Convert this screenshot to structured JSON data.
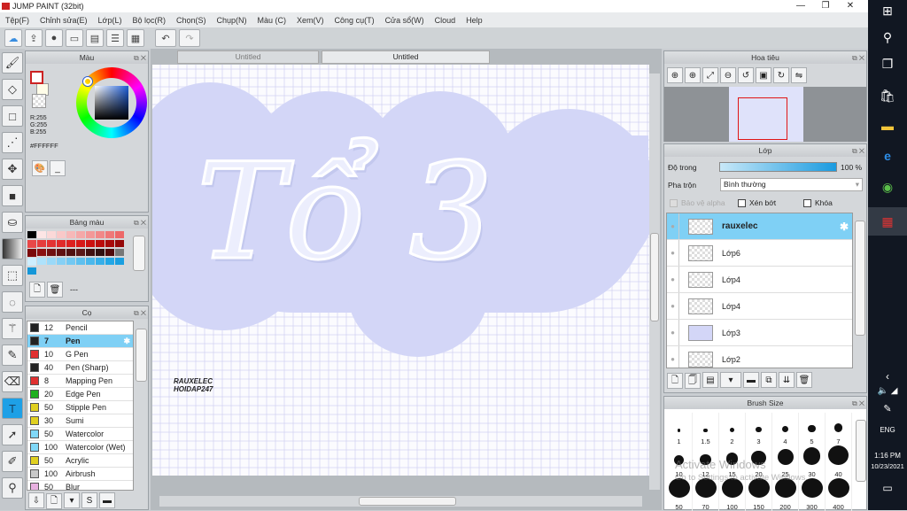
{
  "window": {
    "title": "JUMP PAINT (32bit)",
    "minimize": "—",
    "restore": "❐",
    "close": "✕"
  },
  "menu": [
    "Tệp(F)",
    "Chỉnh sửa(E)",
    "Lớp(L)",
    "Bộ lọc(R)",
    "Chọn(S)",
    "Chụp(N)",
    "Màu (C)",
    "Xem(V)",
    "Công cụ(T)",
    "Cửa sổ(W)",
    "Cloud",
    "Help"
  ],
  "toolbar": {
    "icons": [
      "cloud-icon",
      "share-icon",
      "comment-icon",
      "screen-icon",
      "page-icon",
      "list-icon",
      "grid-icon"
    ],
    "undo": "↶",
    "redo": "↷"
  },
  "color_panel": {
    "title": "Màu",
    "r": "R:255",
    "g": "G:255",
    "b": "B:255",
    "hex": "#FFFFFF",
    "extra_btn": "_"
  },
  "palette_panel": {
    "title": "Bảng màu",
    "label": "---"
  },
  "brush_panel": {
    "title": "Cọ",
    "items": [
      {
        "size": "12",
        "name": "Pencil",
        "color": "#222222"
      },
      {
        "size": "7",
        "name": "Pen",
        "color": "#222222",
        "selected": true
      },
      {
        "size": "10",
        "name": "G Pen",
        "color": "#e03030"
      },
      {
        "size": "40",
        "name": "Pen (Sharp)",
        "color": "#222222"
      },
      {
        "size": "8",
        "name": "Mapping Pen",
        "color": "#e03030"
      },
      {
        "size": "20",
        "name": "Edge Pen",
        "color": "#20b020"
      },
      {
        "size": "50",
        "name": "Stipple Pen",
        "color": "#e0d020"
      },
      {
        "size": "30",
        "name": "Sumi",
        "color": "#e0d020"
      },
      {
        "size": "50",
        "name": "Watercolor",
        "color": "#80d8f8"
      },
      {
        "size": "100",
        "name": "Watercolor (Wet)",
        "color": "#80d8f8"
      },
      {
        "size": "50",
        "name": "Acrylic",
        "color": "#e0d020"
      },
      {
        "size": "100",
        "name": "Airbrush",
        "color": "#c8c8c8"
      },
      {
        "size": "50",
        "name": "Blur",
        "color": "#e8b0e0"
      }
    ]
  },
  "tabs": [
    "Untitled",
    "Untitled"
  ],
  "canvas": {
    "title_text": "Tổ 3",
    "watermark1": "RAUXELEC",
    "watermark2": "HOIDAP247"
  },
  "navigator": {
    "title": "Hoa tiêu"
  },
  "layers": {
    "title": "Lớp",
    "opacity_label": "Độ trong",
    "opacity_value": "100 %",
    "opacity": 100,
    "blend_label": "Pha trộn",
    "blend_value": "Bình thường",
    "protect_alpha": "Bảo vệ alpha",
    "clipping": "Xén bớt",
    "lock": "Khóa",
    "items": [
      {
        "name": "rauxelec",
        "selected": true
      },
      {
        "name": "Lớp6"
      },
      {
        "name": "Lớp4"
      },
      {
        "name": "Lớp4"
      },
      {
        "name": "Lớp3"
      },
      {
        "name": "Lớp2"
      }
    ]
  },
  "brush_size": {
    "title": "Brush Size",
    "sizes": [
      "1",
      "1.5",
      "2",
      "3",
      "4",
      "5",
      "7",
      "10",
      "12",
      "15",
      "20",
      "25",
      "30",
      "40",
      "50",
      "70",
      "100",
      "150",
      "200",
      "300",
      "400"
    ]
  },
  "activation": {
    "line1": "Activate Windows",
    "line2": "Go to Settings to activate Windows."
  },
  "taskbar": {
    "lang": "ENG",
    "time": "1:16 PM",
    "date": "10/23/2021"
  }
}
